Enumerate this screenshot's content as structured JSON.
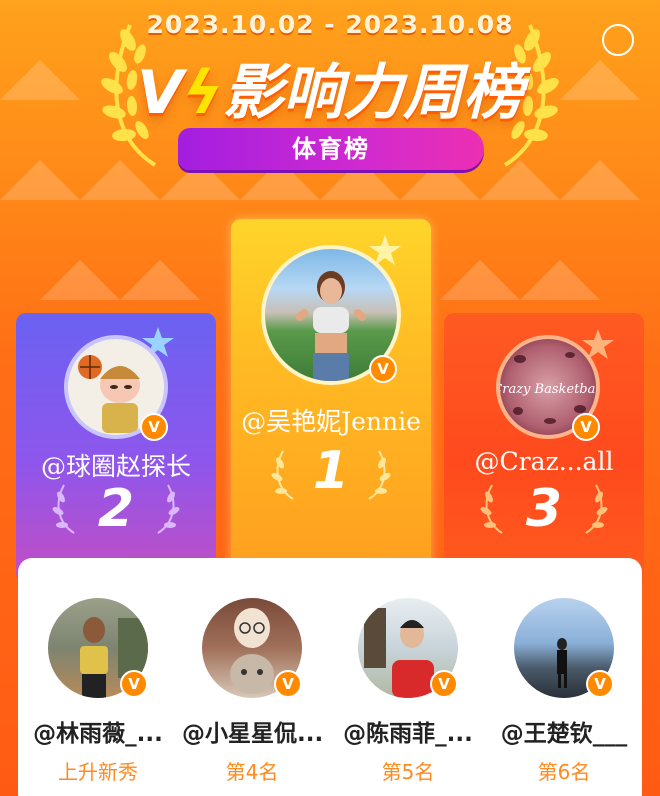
{
  "header": {
    "date_range": "2023.10.02 - 2023.10.08",
    "title_prefix": "V",
    "title_rest": "影响力周榜",
    "category": "体育榜"
  },
  "podium": [
    {
      "rank": "2",
      "name": "@球圈赵探长"
    },
    {
      "rank": "1",
      "name": "@吴艳妮Jennie"
    },
    {
      "rank": "3",
      "name": "@Craz...all"
    }
  ],
  "list": [
    {
      "name": "@林雨薇_...",
      "sub": "上升新秀"
    },
    {
      "name": "@小星星侃...",
      "sub": "第4名"
    },
    {
      "name": "@陈雨菲_...",
      "sub": "第5名"
    },
    {
      "name": "@王楚钦___",
      "sub": "第6名"
    }
  ],
  "badge_letter": "V",
  "logo_text_3": "Crazy Basketball",
  "colors": {
    "accent": "#ff8a1f",
    "gold": "#ffd52a",
    "purple": "#8e56ec",
    "red_orange": "#ff4a1d"
  }
}
